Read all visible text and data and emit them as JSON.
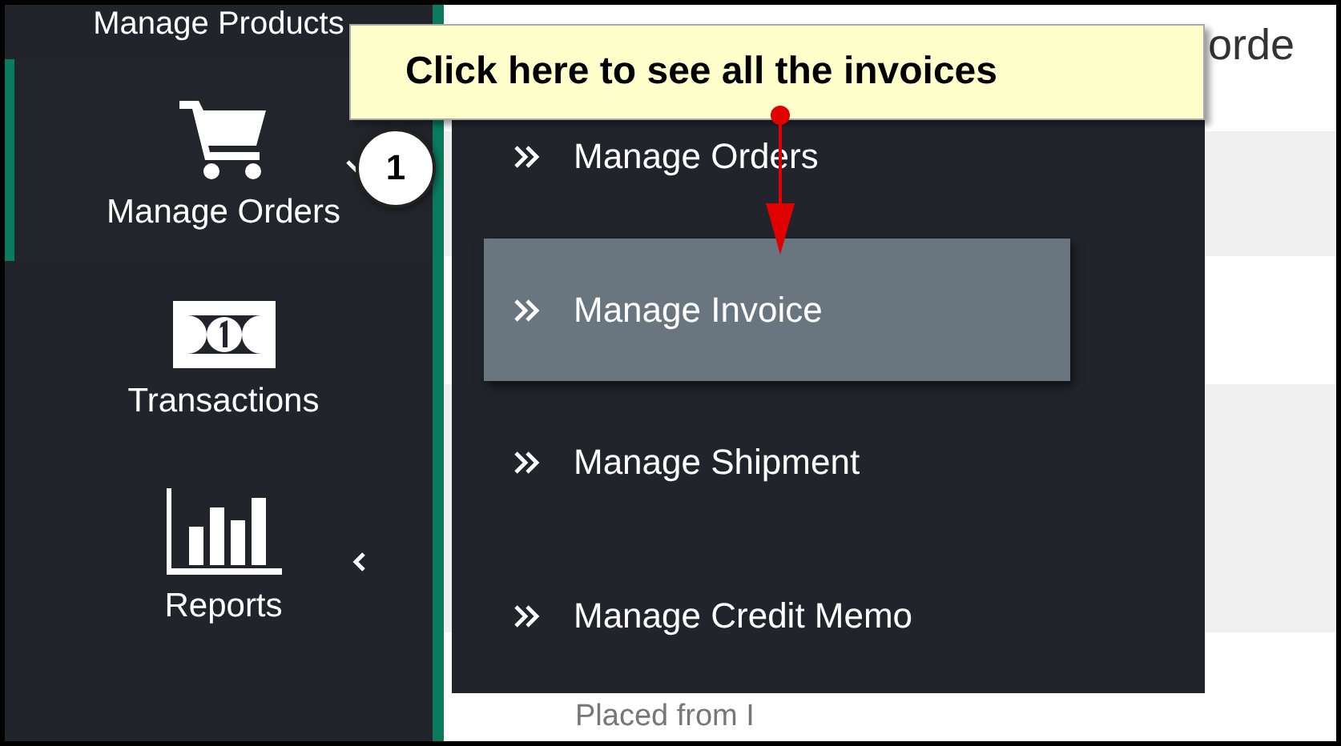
{
  "sidebar": {
    "cut_item_label": "Manage Products",
    "items": [
      {
        "label": "Manage Orders",
        "kind": "cart",
        "selected": true,
        "expanded": true
      },
      {
        "label": "Transactions",
        "kind": "money",
        "selected": false
      },
      {
        "label": "Reports",
        "kind": "chart",
        "selected": false,
        "expanded": false
      }
    ]
  },
  "main": {
    "title": "orde",
    "line": "Placed from I"
  },
  "flyout": {
    "items": [
      {
        "label": "Manage Orders",
        "selected": false
      },
      {
        "label": "Manage Invoice",
        "selected": true
      },
      {
        "label": "Manage Shipment",
        "selected": false
      },
      {
        "label": "Manage Credit Memo",
        "selected": false
      }
    ]
  },
  "tooltip": {
    "text": "Click here to see all the invoices"
  },
  "callout": {
    "number": "1"
  }
}
